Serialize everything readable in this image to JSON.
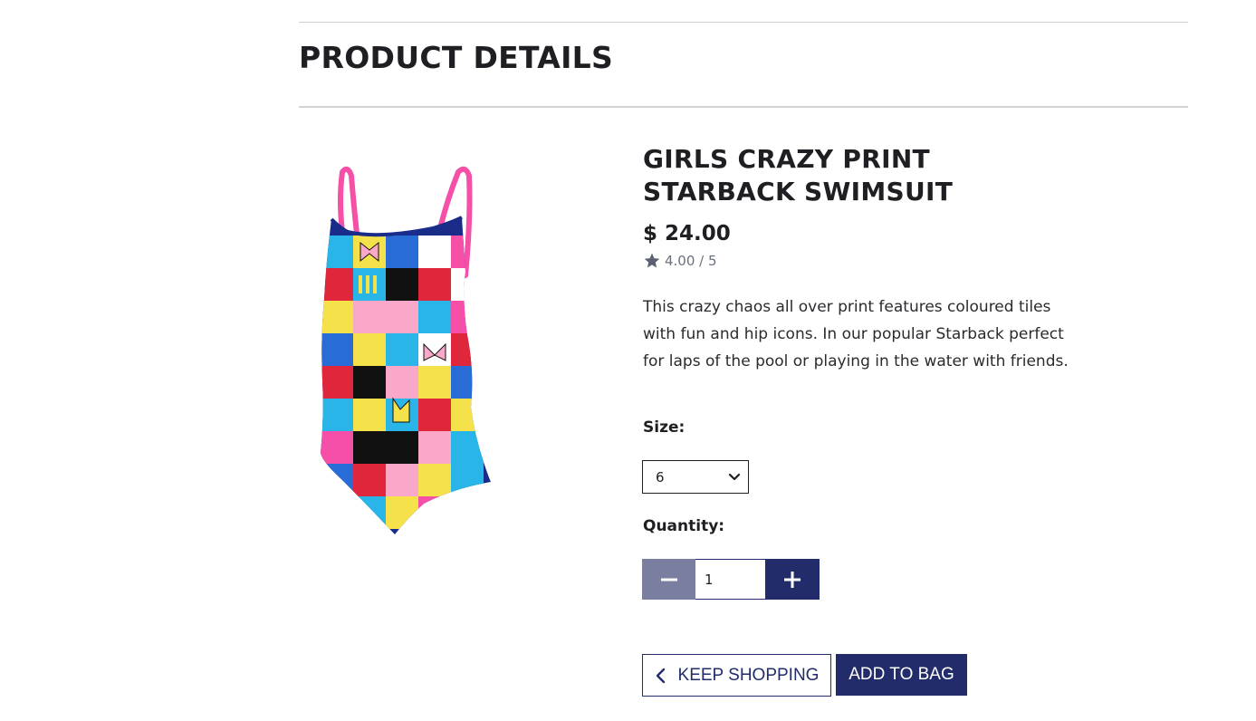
{
  "page": {
    "title": "PRODUCT DETAILS"
  },
  "product": {
    "name": "GIRLS CRAZY PRINT STARBACK SWIMSUIT",
    "price": "$ 24.00",
    "rating": "4.00 / 5",
    "rating_value": 4.0,
    "description": "This crazy chaos all over print features coloured tiles with fun and hip icons. In our popular Starback perfect for laps of the pool or playing in the water with friends.",
    "image_icon": "swimsuit-image"
  },
  "size": {
    "label": "Size:",
    "selected": "6"
  },
  "quantity": {
    "label": "Quantity:",
    "value": "1"
  },
  "actions": {
    "keep_shopping": "KEEP SHOPPING",
    "add_to_bag": "ADD TO BAG"
  },
  "colors": {
    "brand": "#222c6b",
    "muted_button": "#7a7fa2",
    "accent_pink": "#f54fa8"
  }
}
